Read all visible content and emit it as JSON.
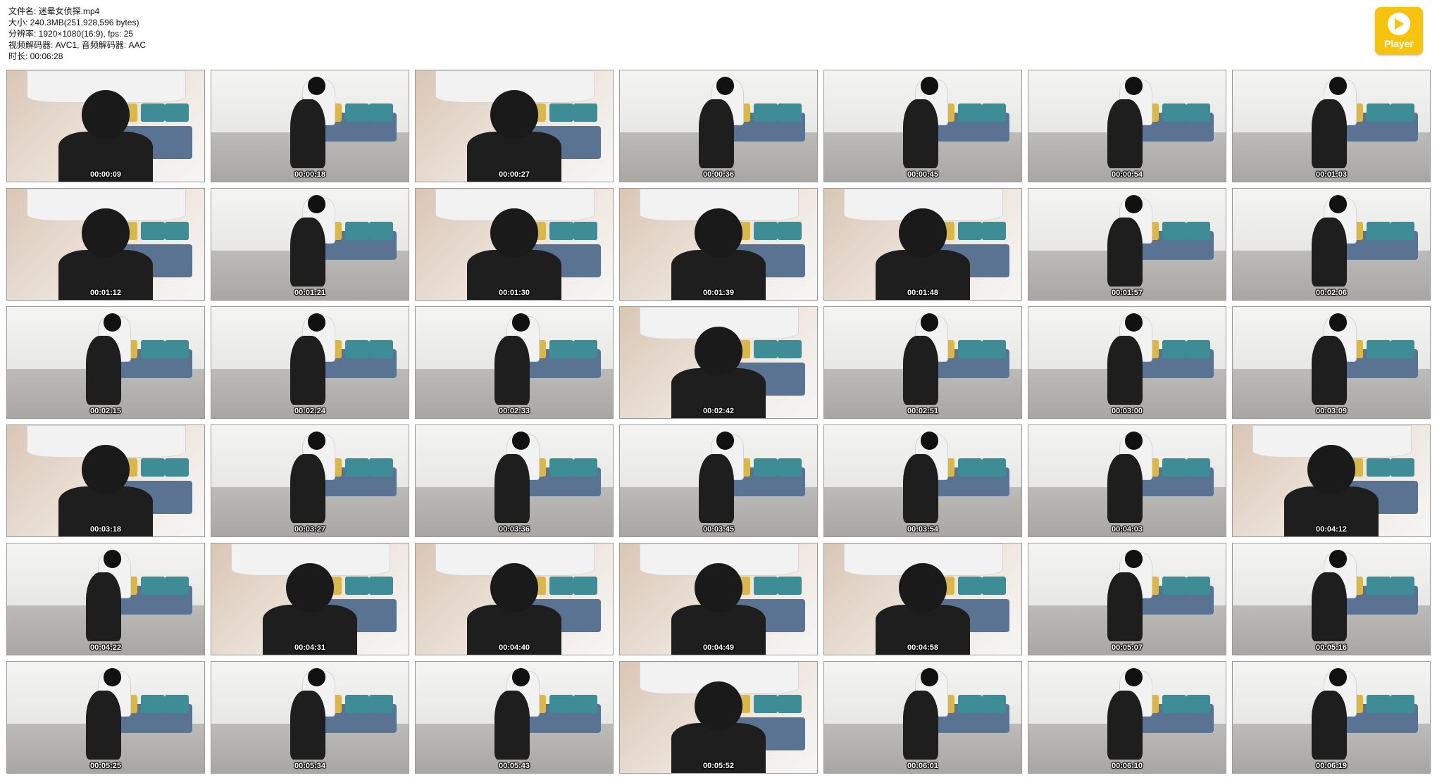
{
  "header": {
    "filename": "文件名: 迷晕女侦探.mp4",
    "size": "大小: 240.3MB(251,928,596 bytes)",
    "resolution": "分辨率: 1920×1080(16:9), fps: 25",
    "codec": "视频解码器: AVC1, 音频解码器: AAC",
    "duration": "时长: 00:06:28"
  },
  "player_badge": {
    "label": "Player",
    "icon": "play-icon",
    "color": "#f6c40e"
  },
  "thumbnails": [
    {
      "time": "00:00:09",
      "shot": "close"
    },
    {
      "time": "00:00:18",
      "shot": "wide"
    },
    {
      "time": "00:00:27",
      "shot": "close"
    },
    {
      "time": "00:00:36",
      "shot": "wide"
    },
    {
      "time": "00:00:45",
      "shot": "wide"
    },
    {
      "time": "00:00:54",
      "shot": "wide"
    },
    {
      "time": "00:01:03",
      "shot": "wide"
    },
    {
      "time": "00:01:12",
      "shot": "close"
    },
    {
      "time": "00:01:21",
      "shot": "wide"
    },
    {
      "time": "00:01:30",
      "shot": "close"
    },
    {
      "time": "00:01:39",
      "shot": "close"
    },
    {
      "time": "00:01:48",
      "shot": "close"
    },
    {
      "time": "00:01:57",
      "shot": "wide"
    },
    {
      "time": "00:02:06",
      "shot": "wide"
    },
    {
      "time": "00:02:15",
      "shot": "wide"
    },
    {
      "time": "00:02:24",
      "shot": "wide"
    },
    {
      "time": "00:02:33",
      "shot": "wide"
    },
    {
      "time": "00:02:42",
      "shot": "close"
    },
    {
      "time": "00:02:51",
      "shot": "wide"
    },
    {
      "time": "00:03:00",
      "shot": "wide"
    },
    {
      "time": "00:03:09",
      "shot": "wide"
    },
    {
      "time": "00:03:18",
      "shot": "close"
    },
    {
      "time": "00:03:27",
      "shot": "wide"
    },
    {
      "time": "00:03:36",
      "shot": "wide"
    },
    {
      "time": "00:03:45",
      "shot": "wide"
    },
    {
      "time": "00:03:54",
      "shot": "wide"
    },
    {
      "time": "00:04:03",
      "shot": "wide"
    },
    {
      "time": "00:04:12",
      "shot": "close"
    },
    {
      "time": "00:04:22",
      "shot": "wide"
    },
    {
      "time": "00:04:31",
      "shot": "close"
    },
    {
      "time": "00:04:40",
      "shot": "close"
    },
    {
      "time": "00:04:49",
      "shot": "close"
    },
    {
      "time": "00:04:58",
      "shot": "close"
    },
    {
      "time": "00:05:07",
      "shot": "wide"
    },
    {
      "time": "00:05:16",
      "shot": "wide"
    },
    {
      "time": "00:05:25",
      "shot": "wide"
    },
    {
      "time": "00:05:34",
      "shot": "wide"
    },
    {
      "time": "00:05:43",
      "shot": "wide"
    },
    {
      "time": "00:05:52",
      "shot": "close"
    },
    {
      "time": "00:06:01",
      "shot": "wide"
    },
    {
      "time": "00:06:10",
      "shot": "wide"
    },
    {
      "time": "00:06:19",
      "shot": "wide"
    }
  ]
}
